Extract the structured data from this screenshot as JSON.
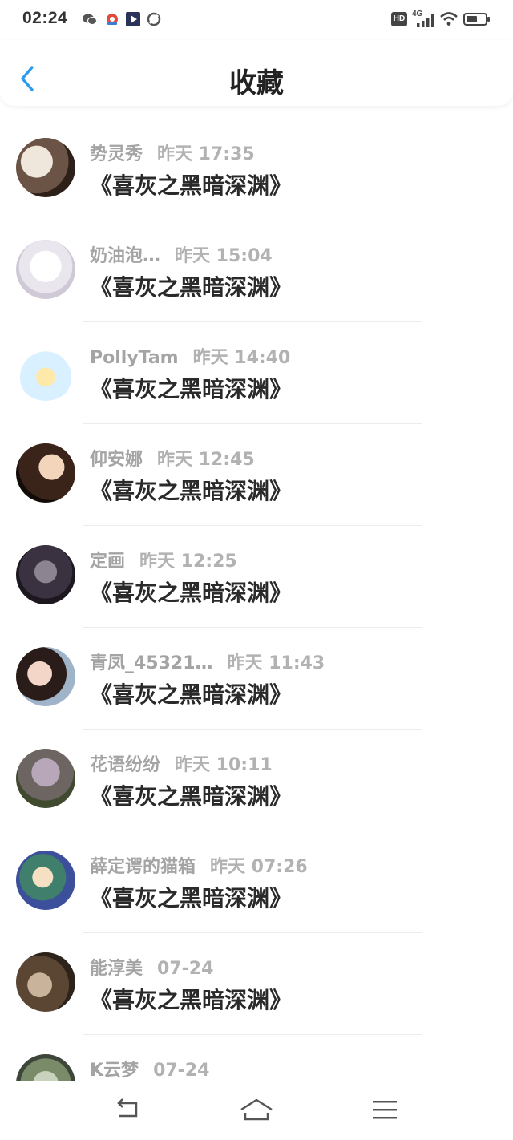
{
  "status": {
    "time": "02:24",
    "network": "4G",
    "hd": "HD"
  },
  "header": {
    "title": "收藏"
  },
  "items": [
    {
      "name": "势灵秀",
      "time": "昨天 17:35",
      "book": "《喜灰之黑暗深渊》"
    },
    {
      "name": "奶油泡…",
      "time": "昨天 15:04",
      "book": "《喜灰之黑暗深渊》"
    },
    {
      "name": "PollyTam",
      "time": "昨天 14:40",
      "book": "《喜灰之黑暗深渊》"
    },
    {
      "name": "仰安娜",
      "time": "昨天 12:45",
      "book": "《喜灰之黑暗深渊》"
    },
    {
      "name": "定画",
      "time": "昨天 12:25",
      "book": "《喜灰之黑暗深渊》"
    },
    {
      "name": "青凤_45321…",
      "time": "昨天 11:43",
      "book": "《喜灰之黑暗深渊》"
    },
    {
      "name": "花语纷纷",
      "time": "昨天 10:11",
      "book": "《喜灰之黑暗深渊》"
    },
    {
      "name": "薛定谔的猫箱",
      "time": "昨天 07:26",
      "book": "《喜灰之黑暗深渊》"
    },
    {
      "name": "能淳美",
      "time": "07-24",
      "book": "《喜灰之黑暗深渊》"
    },
    {
      "name": "K云梦",
      "time": "07-24",
      "book": ""
    }
  ],
  "colors": {
    "accent": "#2c9cf0",
    "title": "#222222",
    "meta": "#a4a4a4"
  },
  "icons": {
    "back": "chevron-left-icon",
    "nav_back": "return-icon",
    "nav_home": "home-icon",
    "nav_menu": "menu-icon"
  }
}
